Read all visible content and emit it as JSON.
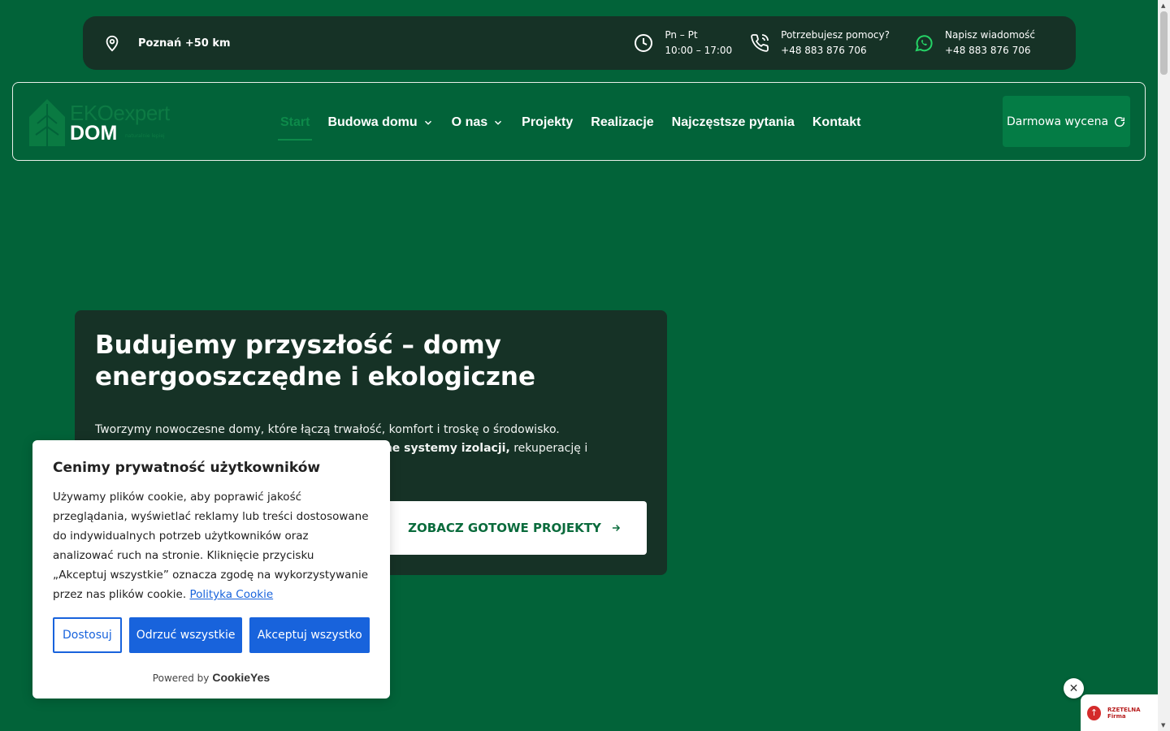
{
  "topbar": {
    "location": "Poznań +50 km",
    "hours": {
      "days": "Pn – Pt",
      "time": "10:00 – 17:00"
    },
    "help": {
      "label": "Potrzebujesz pomocy?",
      "phone": "+48 883 876 706"
    },
    "message": {
      "label": "Napisz wiadomość",
      "phone": "+48 883 876 706"
    }
  },
  "logo": {
    "brand": "EKOexpert",
    "sub": "DOM",
    "tag": "naturalnie lepiej"
  },
  "nav": {
    "items": [
      {
        "label": "Start",
        "active": true,
        "dropdown": false
      },
      {
        "label": "Budowa domu",
        "active": false,
        "dropdown": true
      },
      {
        "label": "O nas",
        "active": false,
        "dropdown": true
      },
      {
        "label": "Projekty",
        "active": false,
        "dropdown": false
      },
      {
        "label": "Realizacje",
        "active": false,
        "dropdown": false
      },
      {
        "label": "Najczęstsze pytania",
        "active": false,
        "dropdown": false
      },
      {
        "label": "Kontakt",
        "active": false,
        "dropdown": false
      }
    ],
    "cta": "Darmowa wycena"
  },
  "hero": {
    "title": "Budujemy przyszłość – domy energooszczędne i ekologiczne",
    "line1": "Tworzymy nowoczesne domy, które łączą trwałość, komfort i troskę o środowisko.",
    "line2_bold": "esne systemy izolacji,",
    "line2_rest": " rekuperację i",
    "button": "ZOBACZ GOTOWE PROJEKTY"
  },
  "cookie": {
    "title": "Cenimy prywatność użytkowników",
    "body": "Używamy plików cookie, aby poprawić jakość przeglądania, wyświetlać reklamy lub treści dostosowane do indywidualnych potrzeb użytkowników oraz analizować ruch na stronie. Kliknięcie przycisku „Akceptuj wszystkie” oznacza zgodę na wykorzystywanie przez nas plików cookie.",
    "link": "Polityka Cookie",
    "customize": "Dostosuj",
    "reject": "Odrzuć wszystkie",
    "accept": "Akceptuj wszystko",
    "powered": "Powered by",
    "powered_brand": "CookieYes"
  },
  "badge": {
    "text": "RZETELNA Firma",
    "close": "✕",
    "up": "↑"
  },
  "colors": {
    "bg": "#026339",
    "panel": "#163226",
    "accent": "#0d8a4a",
    "cookie_blue": "#1863dc"
  }
}
